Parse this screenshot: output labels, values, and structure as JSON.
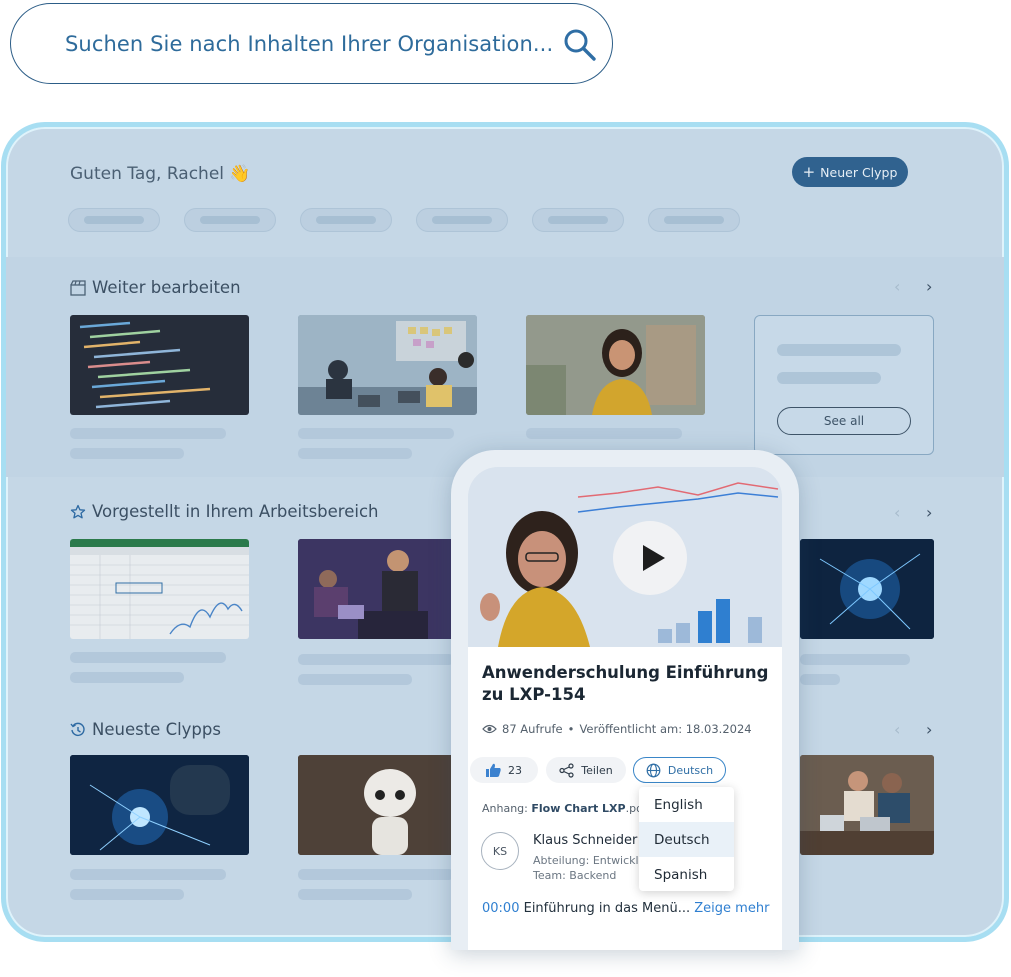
{
  "search": {
    "placeholder": "Suchen Sie nach Inhalten Ihrer Organisation..."
  },
  "header": {
    "greeting": "Guten Tag, Rachel",
    "greeting_emoji": "👋",
    "new_button": "Neuer Clypp"
  },
  "sections": [
    {
      "title": "Weiter bearbeiten",
      "icon": "clapperboard-icon"
    },
    {
      "title": "Vorgestellt in Ihrem Arbeitsbereich",
      "icon": "star-icon"
    },
    {
      "title": "Neueste Clypps",
      "icon": "history-icon"
    }
  ],
  "see_all": "See all",
  "video": {
    "title": "Anwenderschulung Einführung zu LXP-154",
    "views": "87 Aufrufe",
    "published": "Veröffentlicht am: 18.03.2024",
    "likes": "23",
    "share": "Teilen",
    "language": "Deutsch",
    "attachment_label": "Anhang:",
    "attachment_file": "Flow Chart LXP",
    "attachment_ext": ".pdf",
    "author_initials": "KS",
    "author_name": "Klaus Schneider",
    "author_dept": "Abteilung: Entwickl",
    "author_team": "Team: Backend",
    "chapter_time": "00:00",
    "chapter_title": "Einführung in das Menü...",
    "chapter_more": "Zeige mehr"
  },
  "language_menu": {
    "options": [
      "English",
      "Deutsch",
      "Spanish"
    ],
    "selected": "Deutsch"
  },
  "colors": {
    "brand": "#30628f",
    "accent": "#3a86c8",
    "window_border": "#a7def2"
  }
}
